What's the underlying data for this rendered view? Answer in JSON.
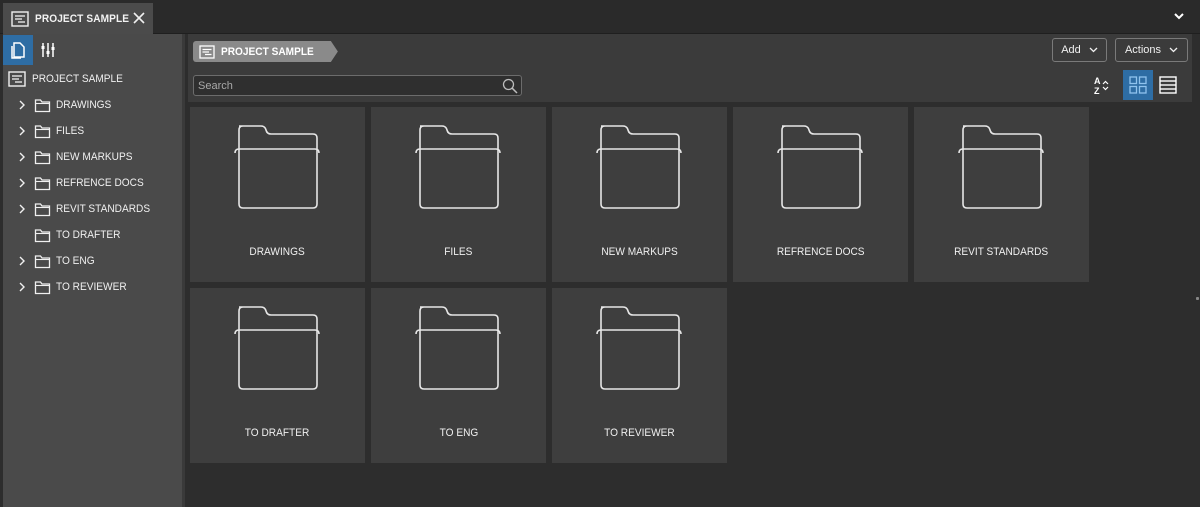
{
  "tab": {
    "label": "PROJECT SAMPLE",
    "icon": "project-icon",
    "close_icon": "close-icon"
  },
  "tabbar": {
    "overflow_icon": "chevron-down-icon"
  },
  "sidebar": {
    "tools": [
      {
        "name": "documents",
        "icon": "documents-icon",
        "active": true
      },
      {
        "name": "filters",
        "icon": "sliders-icon",
        "active": false
      }
    ],
    "root": {
      "label": "PROJECT SAMPLE",
      "icon": "project-icon"
    },
    "items": [
      {
        "label": "DRAWINGS",
        "expandable": true
      },
      {
        "label": "FILES",
        "expandable": true
      },
      {
        "label": "NEW MARKUPS",
        "expandable": true
      },
      {
        "label": "REFRENCE DOCS",
        "expandable": true
      },
      {
        "label": "REVIT STANDARDS",
        "expandable": true
      },
      {
        "label": "TO DRAFTER",
        "expandable": false
      },
      {
        "label": "TO ENG",
        "expandable": true
      },
      {
        "label": "TO REVIEWER",
        "expandable": true
      }
    ]
  },
  "toolbar": {
    "breadcrumb": "PROJECT SAMPLE",
    "search_placeholder": "Search",
    "search_value": "",
    "add_label": "Add",
    "actions_label": "Actions",
    "sort_icon": "sort-az-icon",
    "view_mode": "grid"
  },
  "grid": {
    "folders": [
      {
        "name": "DRAWINGS"
      },
      {
        "name": "FILES"
      },
      {
        "name": "NEW MARKUPS"
      },
      {
        "name": "REFRENCE DOCS"
      },
      {
        "name": "REVIT STANDARDS"
      },
      {
        "name": "TO DRAFTER"
      },
      {
        "name": "TO ENG"
      },
      {
        "name": "TO REVIEWER"
      }
    ]
  },
  "colors": {
    "accent": "#2e6da4",
    "sidebar_bg": "#4a4a4a",
    "card_bg": "#3e3e3e",
    "main_bg": "#2d2d2d"
  }
}
